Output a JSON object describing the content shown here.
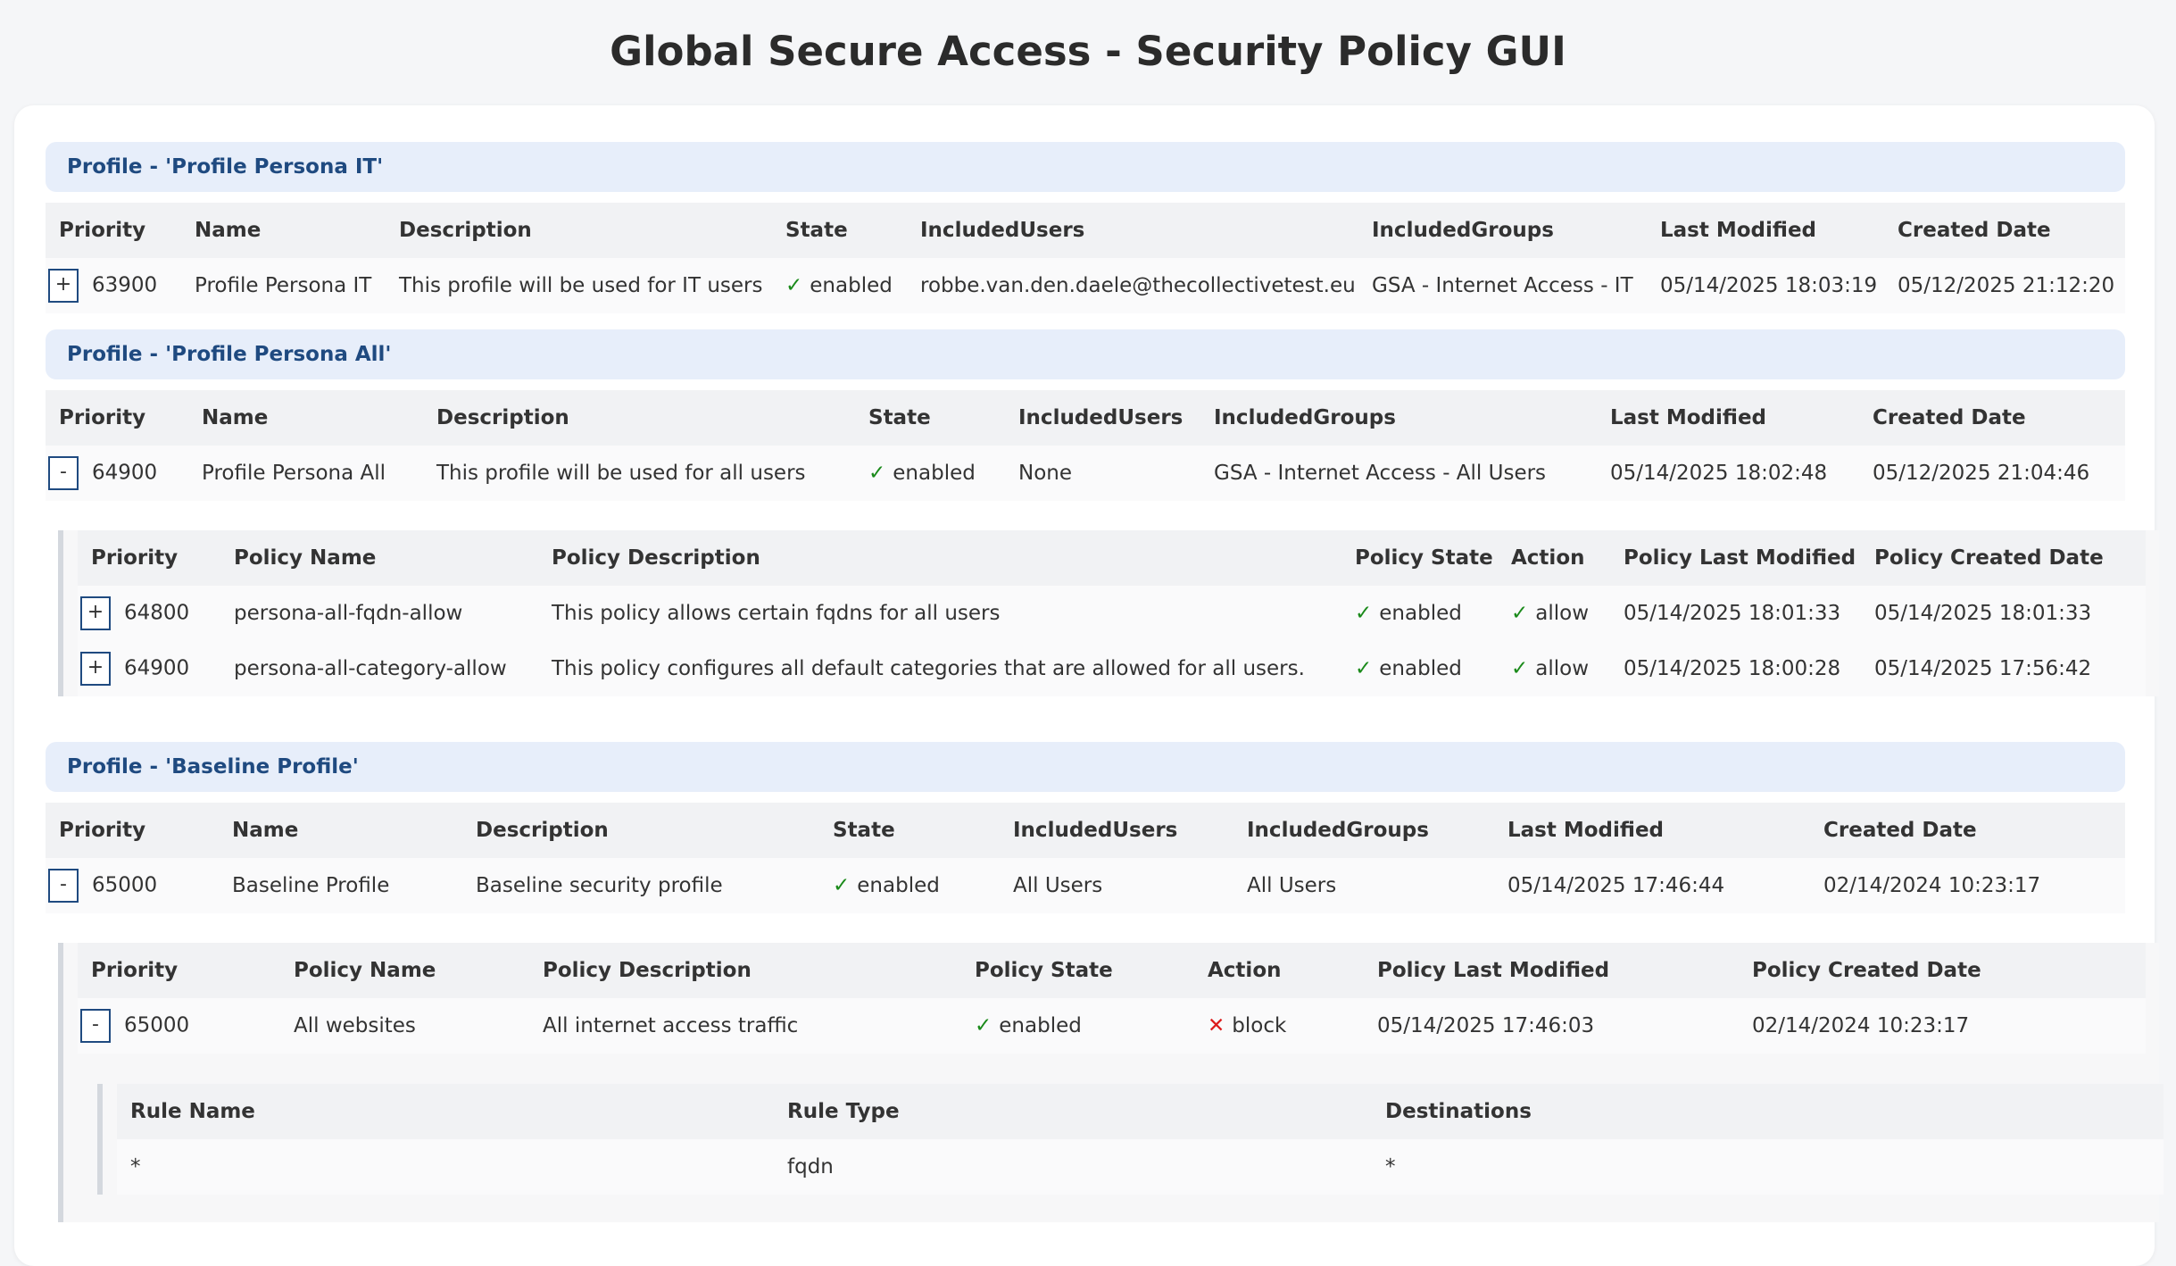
{
  "title": "Global Secure Access - Security Policy GUI",
  "profile_headers": [
    "Priority",
    "Name",
    "Description",
    "State",
    "IncludedUsers",
    "IncludedGroups",
    "Last Modified",
    "Created Date"
  ],
  "policy_headers": [
    "Priority",
    "Policy Name",
    "Policy Description",
    "Policy State",
    "Action",
    "Policy Last Modified",
    "Policy Created Date"
  ],
  "rule_headers": [
    "Rule Name",
    "Rule Type",
    "Destinations"
  ],
  "profiles": [
    {
      "header": "Profile - 'Profile Persona IT'",
      "toggle": "+",
      "priority": "63900",
      "name": "Profile Persona IT",
      "description": "This profile will be used for IT users",
      "state": "enabled",
      "included_users": "robbe.van.den.daele@thecollectivetest.eu",
      "included_groups": "GSA - Internet Access - IT",
      "last_modified": "05/14/2025 18:03:19",
      "created_date": "05/12/2025 21:12:20"
    },
    {
      "header": "Profile - 'Profile Persona All'",
      "toggle": "-",
      "priority": "64900",
      "name": "Profile Persona All",
      "description": "This profile will be used for all users",
      "state": "enabled",
      "included_users": "None",
      "included_groups": "GSA - Internet Access - All Users",
      "last_modified": "05/14/2025 18:02:48",
      "created_date": "05/12/2025 21:04:46",
      "policies": [
        {
          "toggle": "+",
          "priority": "64800",
          "name": "persona-all-fqdn-allow",
          "description": "This policy allows certain fqdns for all users",
          "state": "enabled",
          "action": "allow",
          "last_modified": "05/14/2025 18:01:33",
          "created_date": "05/14/2025 18:01:33"
        },
        {
          "toggle": "+",
          "priority": "64900",
          "name": "persona-all-category-allow",
          "description": "This policy configures all default categories that are allowed for all users.",
          "state": "enabled",
          "action": "allow",
          "last_modified": "05/14/2025 18:00:28",
          "created_date": "05/14/2025 17:56:42"
        }
      ]
    },
    {
      "header": "Profile - 'Baseline Profile'",
      "toggle": "-",
      "priority": "65000",
      "name": "Baseline Profile",
      "description": "Baseline security profile",
      "state": "enabled",
      "included_users": "All Users",
      "included_groups": "All Users",
      "last_modified": "05/14/2025 17:46:44",
      "created_date": "02/14/2024 10:23:17",
      "policies": [
        {
          "toggle": "-",
          "priority": "65000",
          "name": "All websites",
          "description": "All internet access traffic",
          "state": "enabled",
          "action": "block",
          "last_modified": "05/14/2025 17:46:03",
          "created_date": "02/14/2024 10:23:17",
          "rules": [
            {
              "name": "*",
              "type": "fqdn",
              "destinations": "*"
            }
          ]
        }
      ]
    }
  ],
  "icons": {
    "check": "✓",
    "cross": "✕"
  },
  "colors": {
    "accent": "#1f4a80",
    "check": "#1a8a1a",
    "cross": "#dd1c1c",
    "header_bg": "#e7eefa"
  }
}
